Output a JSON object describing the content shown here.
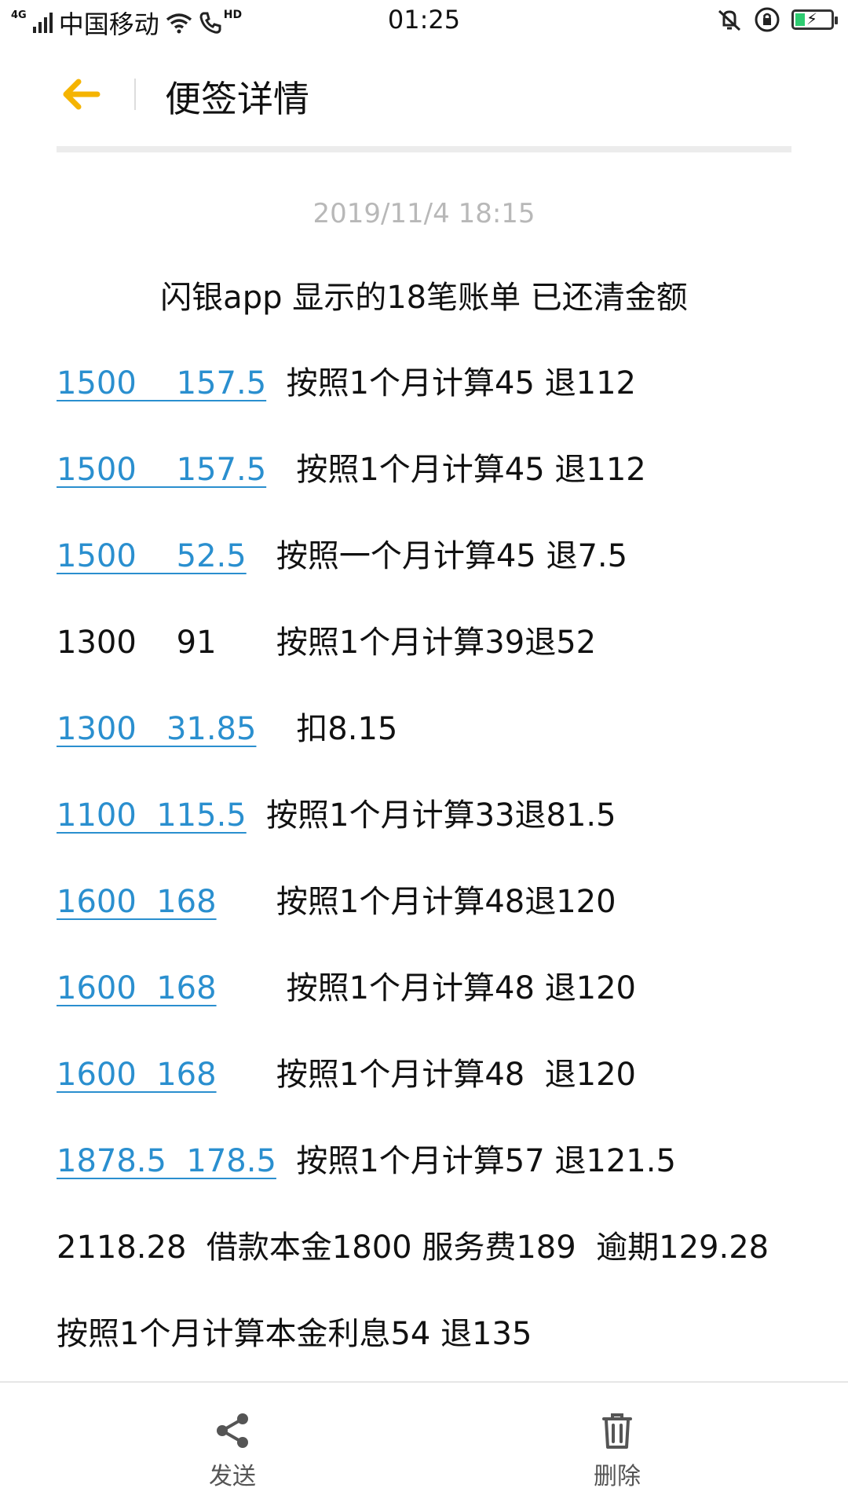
{
  "status_bar": {
    "network": "4G",
    "carrier": "中国移动",
    "hd": "HD",
    "time": "01:25"
  },
  "header": {
    "title": "便签详情"
  },
  "note": {
    "date": "2019/11/4 18:15",
    "heading": "闪银app 显示的18笔账单 已还清金额",
    "rows": [
      {
        "link": "1500    157.5",
        "text": "  按照1个月计算45 退112"
      },
      {
        "link": "1500    157.5",
        "text": "   按照1个月计算45 退112"
      },
      {
        "link": "1500    52.5",
        "text": "   按照一个月计算45 退7.5"
      },
      {
        "link": "",
        "text": "1300    91      按照1个月计算39退52"
      },
      {
        "link": "1300   31.85",
        "text": "    扣8.15"
      },
      {
        "link": "1100  115.5",
        "text": "  按照1个月计算33退81.5"
      },
      {
        "link": "1600  168",
        "text": "      按照1个月计算48退120"
      },
      {
        "link": "1600  168",
        "text": "       按照1个月计算48 退120"
      },
      {
        "link": "1600  168",
        "text": "      按照1个月计算48  退120"
      },
      {
        "link": "1878.5  178.5",
        "text": "  按照1个月计算57 退121.5"
      },
      {
        "link": "",
        "text": "2118.28  借款本金1800 服务费189  逾期129.28"
      },
      {
        "link": "",
        "text": "按照1个月计算本金利息54 退135"
      }
    ]
  },
  "toolbar": {
    "send_label": "发送",
    "delete_label": "删除"
  },
  "icons": {
    "back": "arrow-left-icon",
    "share": "share-icon",
    "delete": "trash-icon"
  },
  "colors": {
    "accent": "#f5b400",
    "link": "#2a8fcf",
    "battery": "#2ecc71"
  }
}
